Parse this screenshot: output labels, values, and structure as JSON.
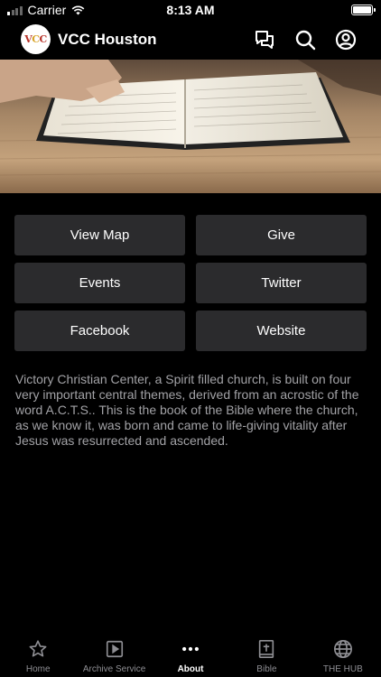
{
  "status_bar": {
    "carrier": "Carrier",
    "time": "8:13 AM",
    "battery_level": 1.0
  },
  "header": {
    "title": "VCC Houston",
    "logo_text": "VCC",
    "icons": [
      "chat-icon",
      "search-icon",
      "profile-icon"
    ]
  },
  "hero": {
    "image": "open-bible-on-wooden-table"
  },
  "buttons": [
    {
      "label": "View Map"
    },
    {
      "label": "Give"
    },
    {
      "label": "Events"
    },
    {
      "label": "Twitter"
    },
    {
      "label": "Facebook"
    },
    {
      "label": "Website"
    }
  ],
  "description": "Victory Christian Center, a Spirit filled church, is built on four very important central themes, derived from an acrostic of the word A.C.T.S..  This is the book of the Bible where the church, as we know it, was born and came to life-giving vitality after Jesus was resurrected and ascended.",
  "tabs": [
    {
      "label": "Home",
      "icon": "star-icon",
      "active": false
    },
    {
      "label": "Archive Service",
      "icon": "play-icon",
      "active": false
    },
    {
      "label": "About",
      "icon": "more-icon",
      "active": true
    },
    {
      "label": "Bible",
      "icon": "bible-icon",
      "active": false
    },
    {
      "label": "THE HUB",
      "icon": "globe-icon",
      "active": false
    }
  ],
  "colors": {
    "background": "#000000",
    "button_bg": "#2b2b2d",
    "description_text": "#a2a2a6",
    "tab_inactive": "#8e8e93",
    "tab_active": "#ffffff"
  }
}
